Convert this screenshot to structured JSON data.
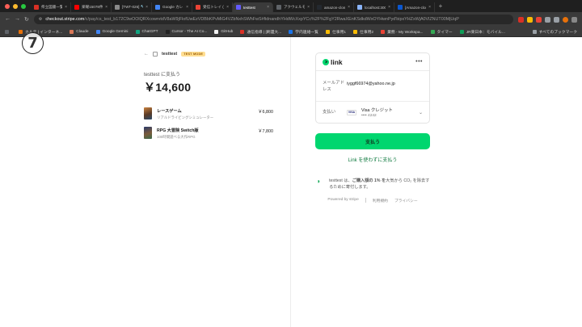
{
  "browser": {
    "tabs": [
      {
        "label": "県立図書一覧（部分）",
        "color": "#d93025",
        "active": false
      },
      {
        "label": "楽曜15078件 - YouTube",
        "color": "#ff0000",
        "active": false
      },
      {
        "label": "[TWT-026] 🔧 ダリ",
        "color": "#8a8a8a",
        "active": false
      },
      {
        "label": "Google カレンダー",
        "color": "#4285f4",
        "active": false
      },
      {
        "label": "受信トレイ (6) - 2024",
        "color": "#ea4335",
        "active": false
      },
      {
        "label": "testtest",
        "color": "#635bff",
        "active": true
      },
      {
        "label": "アクウェルモール(3)",
        "color": "#5f6368",
        "active": false
      },
      {
        "label": "amazon-clone-2",
        "color": "#24292f",
        "active": false
      },
      {
        "label": "localhost:3001",
        "color": "#8ab4f8",
        "active": false
      },
      {
        "label": "[Amazon-clone]",
        "color": "#0b57d0",
        "active": false
      }
    ],
    "url_host": "checkout.stripe.com",
    "url_path": "/c/pay/cs_test_b172C9wOOlQRXcowrvtdV8aW9jFlofUwEzVDBbKPvMiG4VZbNxhSWhFwS#fidnandhYHdWcXxpYCc%2F%2FgY2RwaXEnKSdkdWxOYHwnPyd'bipxYHZxWjA0VlZNUT00MjUqP",
    "bookmarks": [
      {
        "label": "",
        "color": "#5f6368"
      },
      {
        "label": "カルテ | インターネ...",
        "color": "#e8710a"
      },
      {
        "label": "Claude",
        "color": "#d97757"
      },
      {
        "label": "Google Gemini",
        "color": "#4285f4"
      },
      {
        "label": "ChatGPT",
        "color": "#10a37f"
      },
      {
        "label": "Cursor - The AI Co...",
        "color": "#222222"
      },
      {
        "label": "GitHub",
        "color": "#f0f0f0"
      },
      {
        "label": "通信指導 | [刷還大...",
        "color": "#d93025"
      },
      {
        "label": "学内連絡一覧",
        "color": "#1a73e8"
      },
      {
        "label": "仕事用1",
        "color": "#fbbc04"
      },
      {
        "label": "仕事用2",
        "color": "#fbbc04"
      },
      {
        "label": "業務 - My Workspa...",
        "color": "#ea4335"
      },
      {
        "label": "タイマー",
        "color": "#34a853"
      },
      {
        "label": "JR東日本：モバイル...",
        "color": "#0f9d58"
      }
    ],
    "bookmarks_all": "すべてのブックマーク"
  },
  "badge": "7",
  "merchant": {
    "back_icon": "arrow-left-icon",
    "name": "testtest",
    "test_mode": "TEST MODE"
  },
  "summary": {
    "pay_to": "testtest に支払う",
    "amount": "￥14,600"
  },
  "items": [
    {
      "title": "レースゲーム",
      "desc": "リアルドライビングシミュレーター",
      "price": "￥6,800",
      "thumb_color": "#7a4a2a"
    },
    {
      "title": "RPG 大冒険 Switch版",
      "desc": "100時間遊べる大作RPG",
      "price": "￥7,800",
      "thumb_color": "#3c4a7a"
    }
  ],
  "link_card": {
    "brand": "link",
    "email_label": "メールアドレス",
    "email_value": "iyggf66974@yahoo.ne.jp",
    "payment_label": "支払い",
    "card_brand": "VISA",
    "card_name": "Visa クレジット",
    "card_number": "•••• 4242"
  },
  "actions": {
    "pay_button": "支払う",
    "alt_pay": "Link を使わずに支払う"
  },
  "climate": {
    "text_part1": "testtest は、",
    "text_bold": "ご購入額の 1% を",
    "text_part2": "大気から CO₂ を除去するために寄付します。"
  },
  "footer": {
    "powered_by": "Powered by stripe",
    "terms": "利用規約",
    "privacy": "プライバシー"
  },
  "colors": {
    "link_green": "#00d66f",
    "test_mode_bg": "#ffde92"
  }
}
